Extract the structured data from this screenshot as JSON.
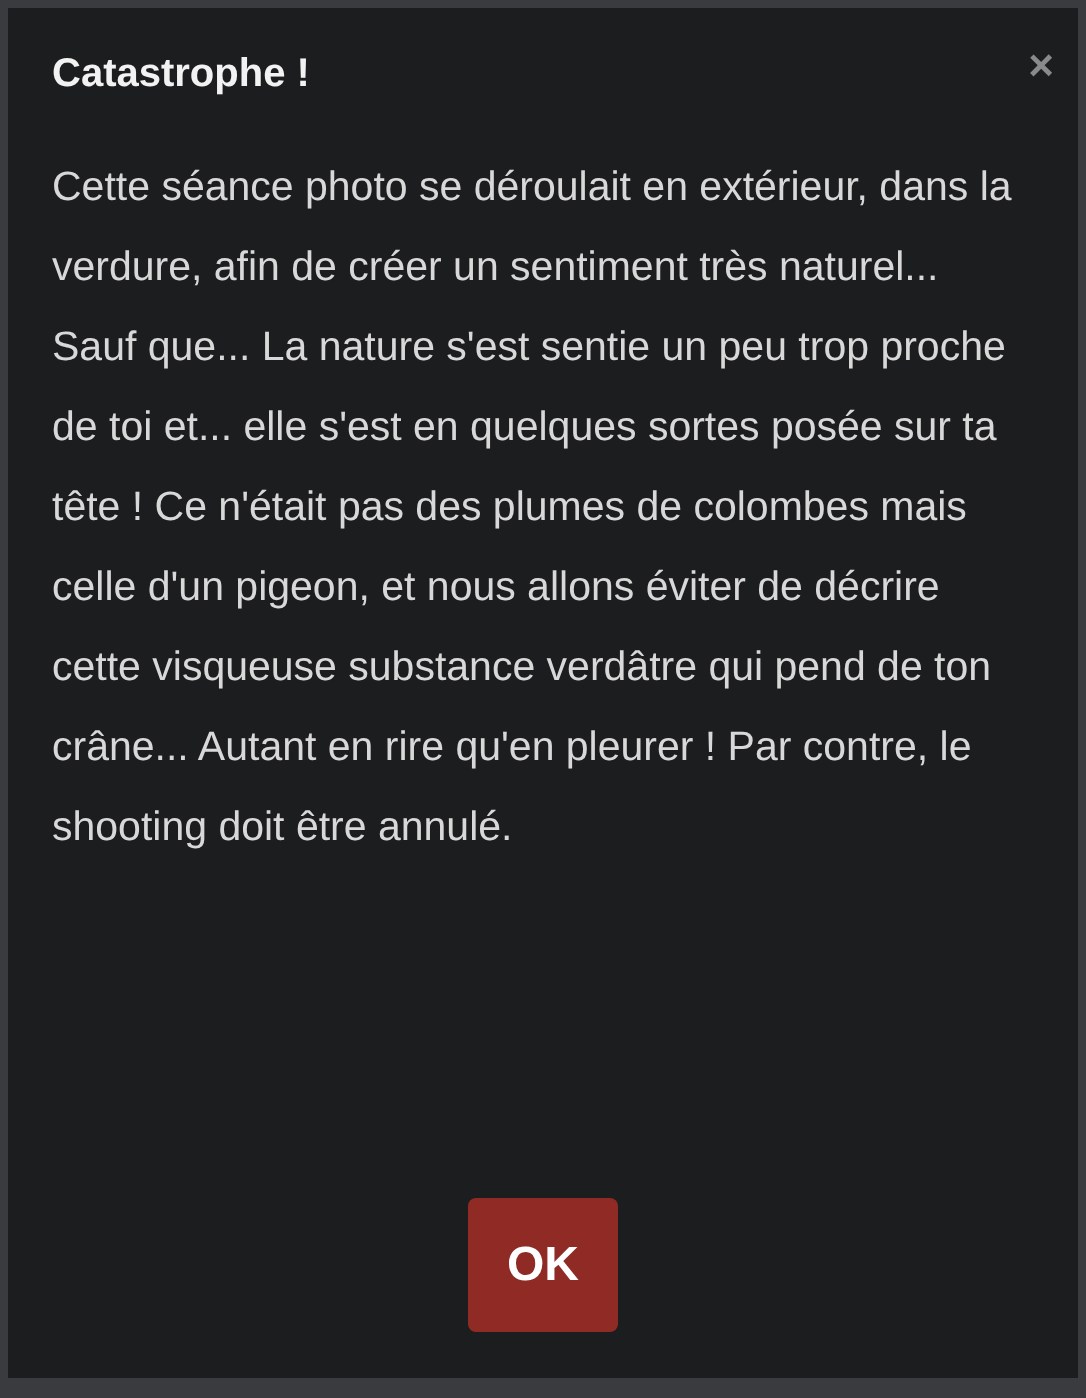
{
  "dialog": {
    "title": "Catastrophe !",
    "close": "×",
    "message": "Cette séance photo se déroulait en extérieur, dans la verdure, afin de créer un sentiment très naturel... Sauf que... La nature s'est sentie un peu trop proche de toi et... elle s'est en quelques sortes posée sur ta tête ! Ce n'était pas des plumes de colombes mais celle d'un pigeon, et nous allons éviter de décrire cette visqueuse substance verdâtre qui pend de ton crâne... Autant en rire qu'en pleurer ! Par contre, le shooting doit être annulé.",
    "buttons": [
      "OK"
    ]
  }
}
